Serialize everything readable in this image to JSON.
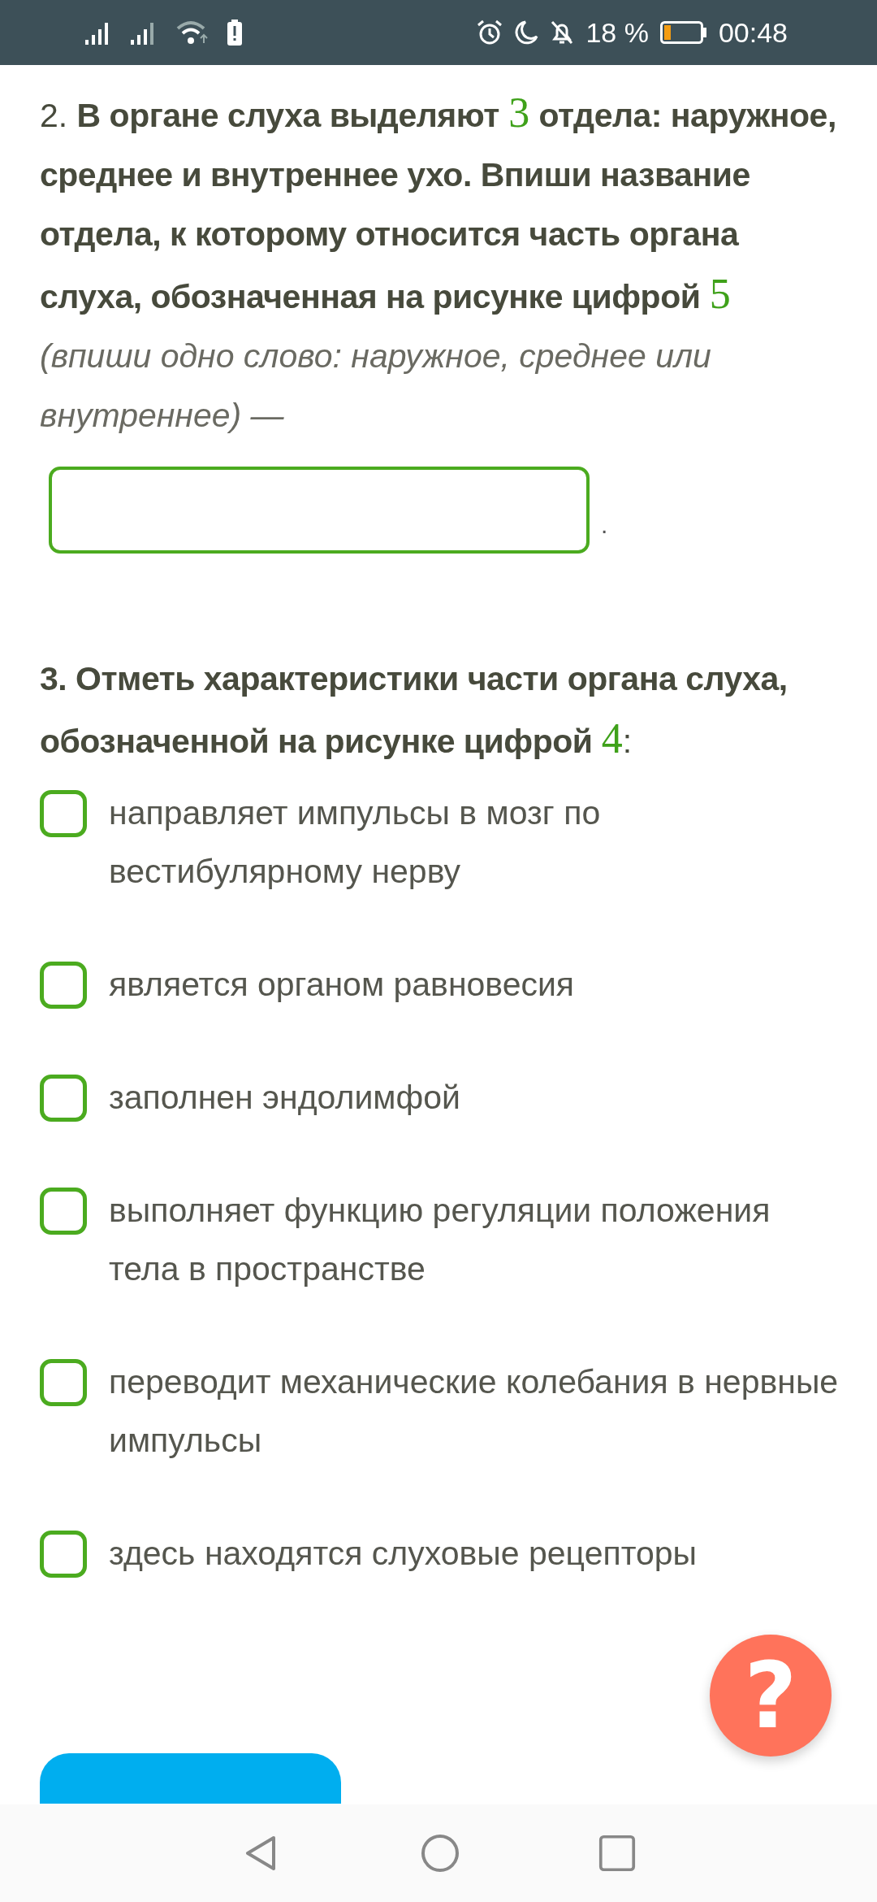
{
  "status_bar": {
    "battery_percent": "18 %",
    "time": "00:48"
  },
  "question_2": {
    "segments": [
      {
        "kind": "plain",
        "text": "2."
      },
      {
        "kind": "bold",
        "text": "В органе слуха выделяют"
      },
      {
        "kind": "math",
        "text": "3"
      },
      {
        "kind": "bold",
        "text": "отдела: наружное, среднее и внутреннее ухо. Впиши название отдела, к которому относится часть органа слуха, обозначенная на рисунке цифрой"
      },
      {
        "kind": "math",
        "text": "5"
      },
      {
        "kind": "hint",
        "text": "(впиши одно слово: наружное, среднее или внутреннее) —"
      }
    ],
    "after_field": "."
  },
  "question_3": {
    "segments": [
      {
        "kind": "bold",
        "text": "3. Отметь характеристики части органа слуха, обозначенной на рисунке цифрой"
      },
      {
        "kind": "math",
        "text": "4"
      },
      {
        "kind": "plain",
        "text": ":"
      }
    ],
    "options": [
      {
        "label": "направляет импульсы в мозг по вестибулярному нерву",
        "checked": false
      },
      {
        "label": "является органом равновесия",
        "checked": false
      },
      {
        "label": "заполнен эндолимфой",
        "checked": false
      },
      {
        "label": "выполняет функцию регуляции положения тела в пространстве",
        "checked": false
      },
      {
        "label": "переводит механические колебания в нервные импульсы",
        "checked": false
      },
      {
        "label": "здесь находятся слуховые рецепторы",
        "checked": false
      }
    ]
  },
  "help_button": {
    "label": "?"
  }
}
